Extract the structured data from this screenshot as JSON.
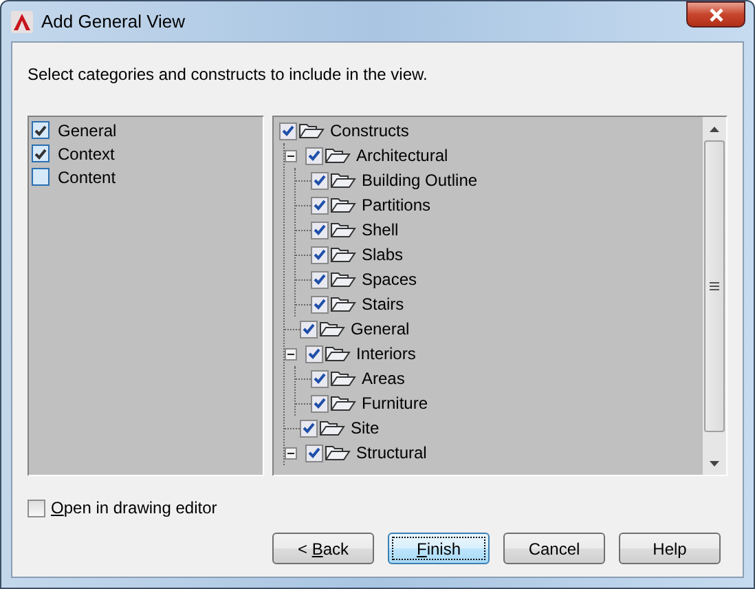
{
  "window": {
    "title": "Add General View"
  },
  "instruction": "Select categories and constructs to include in the view.",
  "categories": [
    {
      "label": "General",
      "checked": true
    },
    {
      "label": "Context",
      "checked": true
    },
    {
      "label": "Content",
      "checked": false
    }
  ],
  "constructs": [
    {
      "label": "Constructs",
      "checked": true,
      "children": [
        {
          "label": "Architectural",
          "checked": true,
          "expanded": true,
          "children": [
            {
              "label": "Building Outline",
              "checked": true
            },
            {
              "label": "Partitions",
              "checked": true
            },
            {
              "label": "Shell",
              "checked": true
            },
            {
              "label": "Slabs",
              "checked": true
            },
            {
              "label": "Spaces",
              "checked": true
            },
            {
              "label": "Stairs",
              "checked": true
            }
          ]
        },
        {
          "label": "General",
          "checked": true
        },
        {
          "label": "Interiors",
          "checked": true,
          "expanded": true,
          "children": [
            {
              "label": "Areas",
              "checked": true
            },
            {
              "label": "Furniture",
              "checked": true
            }
          ]
        },
        {
          "label": "Site",
          "checked": true
        },
        {
          "label": "Structural",
          "checked": true,
          "expanded": true
        }
      ]
    }
  ],
  "open_in_editor": {
    "access_key": "O",
    "label_after": "pen in drawing editor",
    "checked": false
  },
  "buttons": [
    {
      "label_before": "< ",
      "access_key": "B",
      "label_after": "ack",
      "default": false
    },
    {
      "access_key": "F",
      "label_after": "inish",
      "default": true
    },
    {
      "label_before": "Cancel",
      "default": false
    },
    {
      "label_before": "Help",
      "default": false
    }
  ]
}
